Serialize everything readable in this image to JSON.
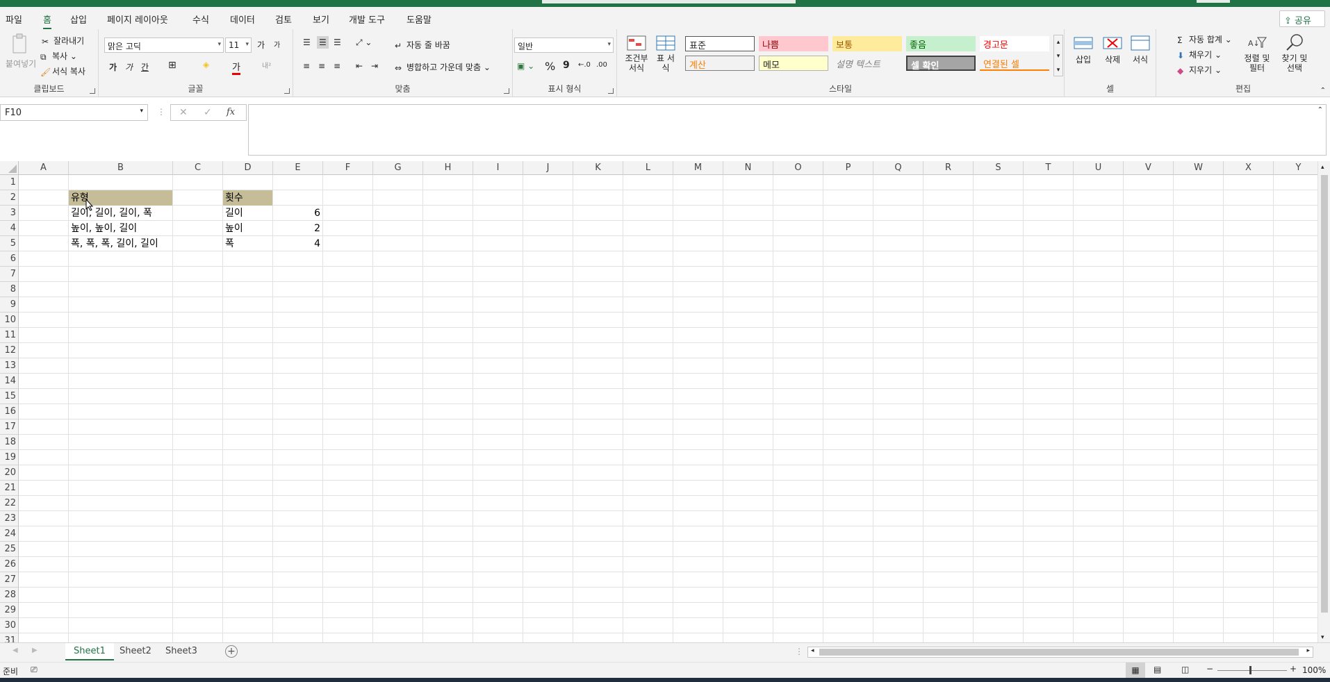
{
  "menu": {
    "tabs": [
      "파일",
      "홈",
      "삽입",
      "페이지 레이아웃",
      "수식",
      "데이터",
      "검토",
      "보기",
      "개발 도구",
      "도움말"
    ],
    "share": "공유"
  },
  "ribbon": {
    "clipboard": {
      "paste": "붙여넣기",
      "cut": "잘라내기",
      "copy": "복사",
      "format_painter": "서식 복사",
      "label": "클립보드"
    },
    "font": {
      "name": "맑은 고딕",
      "size": "11",
      "grow": "가",
      "shrink": "가",
      "bold": "가",
      "italic": "가",
      "underline": "간",
      "font_color_glyph": "가",
      "label": "글꼴"
    },
    "alignment": {
      "wrap": "자동 줄 바꿈",
      "merge": "병합하고 가운데 맞춤",
      "label": "맞춤"
    },
    "number": {
      "format": "일반",
      "percent": "%",
      "comma": "9",
      "label": "표시 형식"
    },
    "styles": {
      "cond_format": "조건부 서식",
      "table_format": "표 서식",
      "cells": [
        "표준",
        "나쁨",
        "보통",
        "좋음",
        "경고문",
        "계산",
        "메모",
        "설명 텍스트",
        "셀 확인",
        "연결된 셀"
      ],
      "label": "스타일"
    },
    "cells": {
      "insert": "삽입",
      "delete": "삭제",
      "format": "서식",
      "label": "셀"
    },
    "editing": {
      "autosum": "자동 합계",
      "fill": "채우기",
      "clear": "지우기",
      "sort": "정렬 및 필터",
      "find": "찾기 및 선택",
      "label": "편집"
    }
  },
  "namebox": "F10",
  "formula": "",
  "fx": "fx",
  "columns": [
    "A",
    "B",
    "C",
    "D",
    "E",
    "F",
    "G",
    "H",
    "I",
    "J",
    "K",
    "L",
    "M",
    "N",
    "O",
    "P",
    "Q",
    "R",
    "S",
    "T",
    "U",
    "V",
    "W",
    "X",
    "Y"
  ],
  "rows": [
    "1",
    "2",
    "3",
    "4",
    "5",
    "6",
    "7",
    "8",
    "9",
    "10",
    "11",
    "12",
    "13",
    "14",
    "15",
    "16",
    "17",
    "18",
    "19",
    "20",
    "21",
    "22",
    "23",
    "24",
    "25",
    "26",
    "27",
    "28",
    "29",
    "30",
    "31"
  ],
  "cells": {
    "B2": "유형",
    "D2": "횟수",
    "B3": "길이, 길이, 길이, 폭",
    "B4": "높이, 높이, 길이",
    "B5": "폭, 폭, 폭, 길이, 길이",
    "D3": "길이",
    "D4": "높이",
    "D5": "폭",
    "E3": "6",
    "E4": "2",
    "E5": "4"
  },
  "header_fill": "#c4bd97",
  "sheets": [
    "Sheet1",
    "Sheet2",
    "Sheet3"
  ],
  "status": {
    "mode": "준비",
    "zoom": "100%"
  },
  "colors": {
    "accent": "#217346",
    "bad": "#ffc7ce",
    "neutral": "#ffeb9c",
    "good": "#c6efce",
    "calc": "#f2f2f2",
    "check": "#a5a5a5"
  }
}
